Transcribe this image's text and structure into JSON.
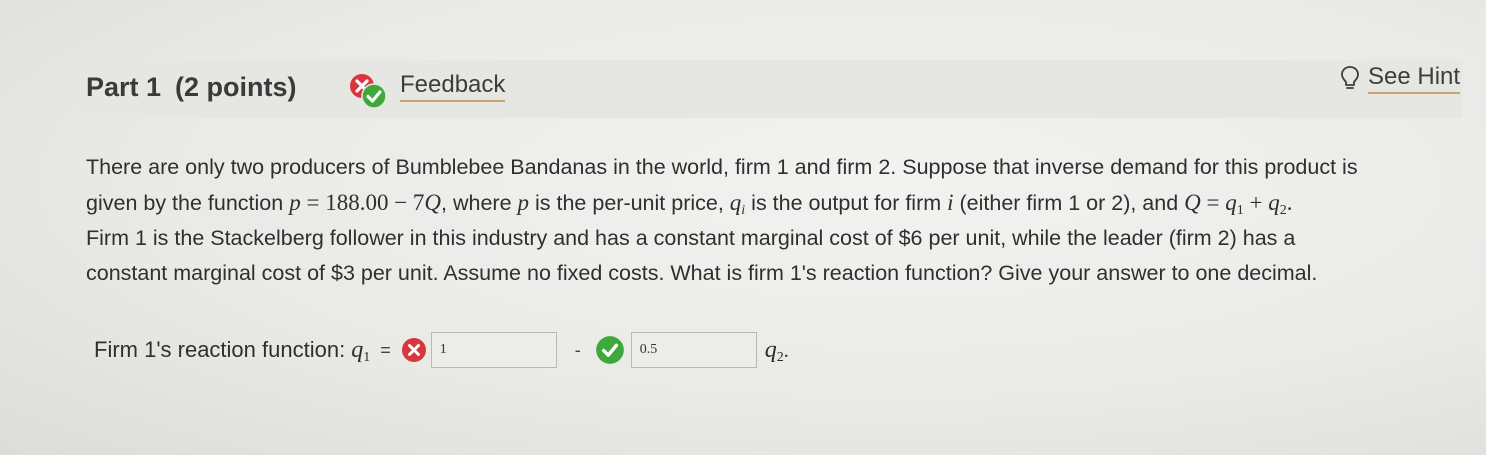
{
  "header": {
    "part_label": "Part 1",
    "points_label": "(2 points)",
    "feedback_label": "Feedback",
    "hint_label": "See Hint"
  },
  "question": {
    "line1": "There are only two producers of Bumblebee Bandanas in the world, firm 1 and firm 2. Suppose that inverse demand for this product is",
    "line2_a": "given by the function ",
    "line2_p": "p",
    "line2_eq": " = ",
    "line2_val": "188.00",
    "line2_minus": " − 7",
    "line2_Q": "Q",
    "line2_b": ", where ",
    "line2_p2": "p",
    "line2_c": " is the per-unit price, ",
    "line2_qi": "q",
    "line2_qi_sub": "i",
    "line2_d": " is the output for firm ",
    "line2_i": "i",
    "line2_e": " (either firm 1 or 2), and ",
    "line2_Q2": "Q",
    "line2_f": " = ",
    "line2_q1": "q",
    "line2_q1_sub": "1",
    "line2_plus": " + ",
    "line2_q2": "q",
    "line2_q2_sub": "2",
    "line2_end": ".",
    "line3": "Firm 1 is the Stackelberg follower in this industry and has a constant marginal cost of $6 per unit, while the leader (firm 2) has a",
    "line4": "constant marginal cost of $3 per unit. Assume no fixed costs. What is firm 1's reaction function? Give your answer to one decimal."
  },
  "answer": {
    "label": "Firm 1's reaction function: ",
    "q1_symbol": "q",
    "q1_sub": "1",
    "equals": "=",
    "input1_value": "1",
    "input1_status": "incorrect",
    "minus": "-",
    "input2_value": "0.5",
    "input2_status": "correct",
    "q2_symbol": "q",
    "q2_sub": "2",
    "period": "."
  },
  "colors": {
    "incorrect": "#d9363e",
    "correct": "#3ea83a",
    "underline": "#c8a56c"
  },
  "icons": {
    "feedback": "mixed-feedback-icon",
    "hint": "lightbulb-icon",
    "incorrect": "x-circle-icon",
    "correct": "check-circle-icon"
  }
}
